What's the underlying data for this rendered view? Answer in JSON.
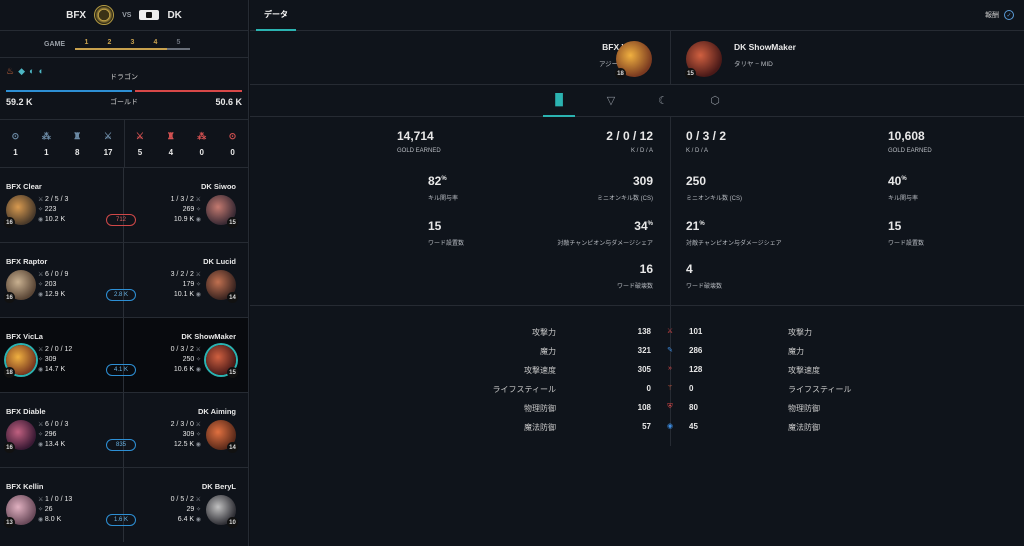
{
  "header": {
    "team_left": "BFX",
    "vs": "VS",
    "team_right": "DK"
  },
  "games": {
    "label": "GAME",
    "items": [
      "1",
      "2",
      "3",
      "4",
      "5"
    ]
  },
  "dragon": {
    "label": "ドラゴン",
    "icons": [
      "fire-drake-icon",
      "ocean-drake-icon",
      "cloud-drake-icon",
      "cloud-drake-icon"
    ]
  },
  "gold": {
    "left": "59.2 K",
    "label": "ゴールド",
    "right": "50.6 K",
    "left_value": 59.2,
    "right_value": 50.6
  },
  "objectives": {
    "left": [
      {
        "icon": "tower-icon",
        "value": "1"
      },
      {
        "icon": "baron-icon",
        "value": "1"
      },
      {
        "icon": "inhibitor-icon",
        "value": "8"
      },
      {
        "icon": "kill-icon",
        "value": "17"
      }
    ],
    "right": [
      {
        "icon": "kill-icon",
        "value": "5"
      },
      {
        "icon": "inhibitor-icon",
        "value": "4"
      },
      {
        "icon": "baron-icon",
        "value": "0"
      },
      {
        "icon": "tower-icon",
        "value": "0"
      }
    ]
  },
  "matchups": [
    {
      "l": {
        "name": "BFX Clear",
        "lvl": "16",
        "kda": "2 / 5 / 3",
        "cs": "223",
        "gold": "10.2 K"
      },
      "r": {
        "name": "DK Siwoo",
        "lvl": "15",
        "kda": "1 / 3 / 2",
        "cs": "269",
        "gold": "10.9 K"
      },
      "diff": "712",
      "diff_color": "red"
    },
    {
      "l": {
        "name": "BFX Raptor",
        "lvl": "16",
        "kda": "6 / 0 / 9",
        "cs": "203",
        "gold": "12.9 K"
      },
      "r": {
        "name": "DK Lucid",
        "lvl": "14",
        "kda": "3 / 2 / 2",
        "cs": "179",
        "gold": "10.1 K"
      },
      "diff": "2.8 K",
      "diff_color": "blue"
    },
    {
      "l": {
        "name": "BFX VicLa",
        "lvl": "18",
        "kda": "2 / 0 / 12",
        "cs": "309",
        "gold": "14.7 K"
      },
      "r": {
        "name": "DK ShowMaker",
        "lvl": "15",
        "kda": "0 / 3 / 2",
        "cs": "250",
        "gold": "10.6 K"
      },
      "diff": "4.1 K",
      "diff_color": "blue"
    },
    {
      "l": {
        "name": "BFX Diable",
        "lvl": "16",
        "kda": "6 / 0 / 3",
        "cs": "296",
        "gold": "13.4 K"
      },
      "r": {
        "name": "DK Aiming",
        "lvl": "14",
        "kda": "2 / 3 / 0",
        "cs": "309",
        "gold": "12.5 K"
      },
      "diff": "835",
      "diff_color": "blue"
    },
    {
      "l": {
        "name": "BFX Kellin",
        "lvl": "13",
        "kda": "1 / 0 / 13",
        "cs": "26",
        "gold": "8.0 K"
      },
      "r": {
        "name": "DK BeryL",
        "lvl": "10",
        "kda": "0 / 5 / 2",
        "cs": "29",
        "gold": "6.4 K"
      },
      "diff": "1.6 K",
      "diff_color": "blue"
    }
  ],
  "main": {
    "tab": "データ",
    "report": "報酬",
    "left_player": {
      "name": "BFX VicLa",
      "sub": "アジール − MID",
      "lvl": "18"
    },
    "right_player": {
      "name": "DK ShowMaker",
      "sub": "タリヤ − MID",
      "lvl": "15"
    },
    "icon_tabs": [
      "stats-chart-icon",
      "rune-icon",
      "damage-icon",
      "item-icon"
    ],
    "stats": {
      "l_gold": "14,714",
      "l_gold_k": "GOLD EARNED",
      "l_kda": "2 / 0 / 12",
      "l_kda_k": "K / D / A",
      "r_kda": "0 / 3 / 2",
      "r_kda_k": "K / D / A",
      "r_gold": "10,608",
      "r_gold_k": "GOLD EARNED",
      "l_kp": "82",
      "l_kp_k": "キル関与率",
      "l_cs": "309",
      "l_cs_k": "ミニオンキル数 (CS)",
      "r_cs": "250",
      "r_cs_k": "ミニオンキル数 (CS)",
      "r_kp": "40",
      "r_kp_k": "キル関与率",
      "l_ward": "15",
      "l_ward_k": "ワード設置数",
      "l_dmg": "34",
      "l_dmg_k": "対敵チャンピオン与ダメージシェア",
      "r_dmg": "21",
      "r_dmg_k": "対敵チャンピオン与ダメージシェア",
      "r_ward": "15",
      "r_ward_k": "ワード設置数",
      "l_wk": "16",
      "l_wk_k": "ワード破壊数",
      "r_wk": "4",
      "r_wk_k": "ワード破壊数",
      "pct": "%"
    },
    "attributes": [
      {
        "label": "攻撃力",
        "l": "138",
        "r": "101",
        "icon": "attack-damage-icon",
        "color": "#e04848"
      },
      {
        "label": "魔力",
        "l": "321",
        "r": "286",
        "icon": "ability-power-icon",
        "color": "#3c8ce0"
      },
      {
        "label": "攻撃速度",
        "l": "305",
        "r": "128",
        "icon": "attack-speed-icon",
        "color": "#e04848"
      },
      {
        "label": "ライフスティール",
        "l": "0",
        "r": "0",
        "icon": "life-steal-icon",
        "color": "#e06040"
      },
      {
        "label": "物理防御",
        "l": "108",
        "r": "80",
        "icon": "armor-icon",
        "color": "#e04848"
      },
      {
        "label": "魔法防御",
        "l": "57",
        "r": "45",
        "icon": "magic-resist-icon",
        "color": "#3c8ce0"
      }
    ]
  }
}
